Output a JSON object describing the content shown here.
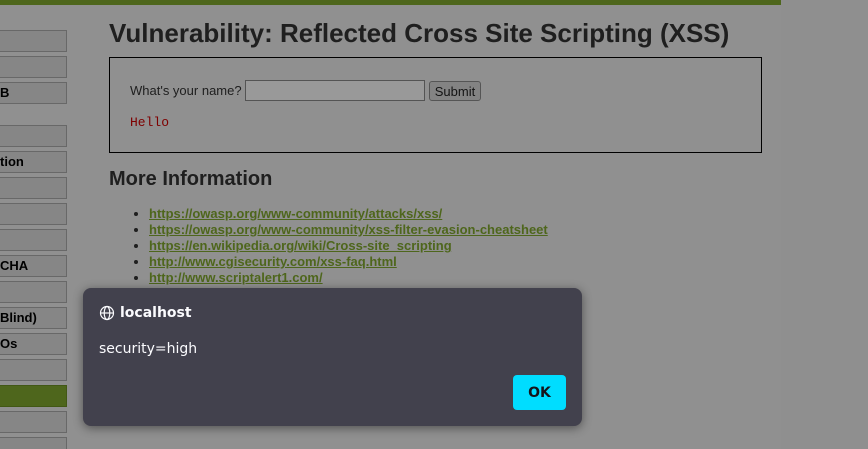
{
  "sidebar": {
    "items": [
      {
        "label": "",
        "selected": false
      },
      {
        "label": "",
        "selected": false
      },
      {
        "label": "B",
        "selected": false
      },
      {
        "label": "",
        "selected": false
      },
      {
        "label": "tion",
        "selected": false
      },
      {
        "label": "",
        "selected": false
      },
      {
        "label": "",
        "selected": false
      },
      {
        "label": "",
        "selected": false
      },
      {
        "label": "CHA",
        "selected": false
      },
      {
        "label": "",
        "selected": false
      },
      {
        "label": "Blind)",
        "selected": false
      },
      {
        "label": "Os",
        "selected": false
      },
      {
        "label": "",
        "selected": false
      },
      {
        "label": "",
        "selected": true
      },
      {
        "label": "",
        "selected": false
      },
      {
        "label": "",
        "selected": false
      }
    ]
  },
  "main": {
    "title": "Vulnerability: Reflected Cross Site Scripting (XSS)",
    "form": {
      "name_label": "What's your name?",
      "name_value": "",
      "submit_label": "Submit",
      "output_text": "Hello"
    },
    "more_info_heading": "More Information",
    "links": [
      "https://owasp.org/www-community/attacks/xss/",
      "https://owasp.org/www-community/xss-filter-evasion-cheatsheet",
      "https://en.wikipedia.org/wiki/Cross-site_scripting",
      "http://www.cgisecurity.com/xss-faq.html",
      "http://www.scriptalert1.com/"
    ]
  },
  "dialog": {
    "origin": "localhost",
    "origin_icon": "globe-icon",
    "message": "security=high",
    "ok_label": "OK"
  },
  "colors": {
    "accent_green": "#7ea52e",
    "dialog_bg": "#42414d",
    "ok_button": "#00ddff",
    "output_red": "#cc0000"
  }
}
